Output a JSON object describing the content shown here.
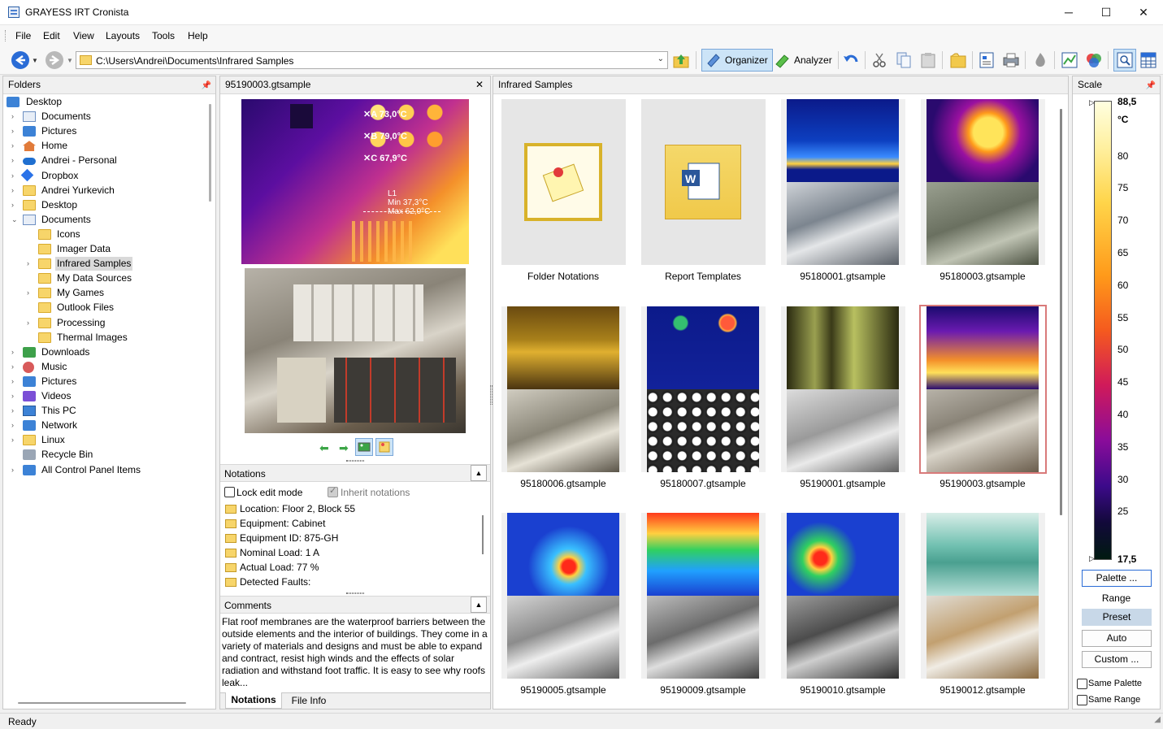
{
  "window": {
    "title": "GRAYESS IRT Cronista",
    "minimize": "─",
    "maximize": "☐",
    "close": "✕"
  },
  "menu": [
    "File",
    "Edit",
    "View",
    "Layouts",
    "Tools",
    "Help"
  ],
  "toolbar": {
    "path": "C:\\Users\\Andrei\\Documents\\Infrared Samples",
    "organizer_label": "Organizer",
    "analyzer_label": "Analyzer"
  },
  "folders": {
    "title": "Folders",
    "items": [
      {
        "label": "Desktop",
        "icon": "desktop-icon",
        "depth": 0,
        "expander": ""
      },
      {
        "label": "Documents",
        "icon": "documents-icon",
        "depth": 1,
        "expander": "›"
      },
      {
        "label": "Pictures",
        "icon": "pictures-icon",
        "depth": 1,
        "expander": "›"
      },
      {
        "label": "Home",
        "icon": "home-icon",
        "depth": 1,
        "expander": "›"
      },
      {
        "label": "Andrei - Personal",
        "icon": "onedrive-icon",
        "depth": 1,
        "expander": "›"
      },
      {
        "label": "Dropbox",
        "icon": "dropbox-icon",
        "depth": 1,
        "expander": "›"
      },
      {
        "label": "Andrei Yurkevich",
        "icon": "folder-icon",
        "depth": 1,
        "expander": "›"
      },
      {
        "label": "Desktop",
        "icon": "folder-icon",
        "depth": 1,
        "expander": "›"
      },
      {
        "label": "Documents",
        "icon": "documents-icon",
        "depth": 1,
        "expander": "⌄"
      },
      {
        "label": "Icons",
        "icon": "folder-icon",
        "depth": 2,
        "expander": ""
      },
      {
        "label": "Imager Data",
        "icon": "folder-icon",
        "depth": 2,
        "expander": ""
      },
      {
        "label": "Infrared Samples",
        "icon": "folder-icon",
        "depth": 2,
        "expander": "›"
      },
      {
        "label": "My Data Sources",
        "icon": "data-sources-icon",
        "depth": 2,
        "expander": ""
      },
      {
        "label": "My Games",
        "icon": "folder-icon",
        "depth": 2,
        "expander": "›"
      },
      {
        "label": "Outlook Files",
        "icon": "folder-icon",
        "depth": 2,
        "expander": ""
      },
      {
        "label": "Processing",
        "icon": "folder-icon",
        "depth": 2,
        "expander": "›"
      },
      {
        "label": "Thermal Images",
        "icon": "folder-icon",
        "depth": 2,
        "expander": ""
      },
      {
        "label": "Downloads",
        "icon": "downloads-icon",
        "depth": 1,
        "expander": "›"
      },
      {
        "label": "Music",
        "icon": "music-icon",
        "depth": 1,
        "expander": "›"
      },
      {
        "label": "Pictures",
        "icon": "pictures-icon",
        "depth": 1,
        "expander": "›"
      },
      {
        "label": "Videos",
        "icon": "videos-icon",
        "depth": 1,
        "expander": "›"
      },
      {
        "label": "This PC",
        "icon": "this-pc-icon",
        "depth": 1,
        "expander": "›"
      },
      {
        "label": "Network",
        "icon": "network-icon",
        "depth": 1,
        "expander": "›"
      },
      {
        "label": "Linux",
        "icon": "linux-icon",
        "depth": 1,
        "expander": "›"
      },
      {
        "label": "Recycle Bin",
        "icon": "recycle-bin-icon",
        "depth": 1,
        "expander": ""
      },
      {
        "label": "All Control Panel Items",
        "icon": "control-panel-icon",
        "depth": 1,
        "expander": "›"
      }
    ],
    "selected": "Infrared Samples"
  },
  "preview": {
    "title": "95190003.gtsample",
    "markers": [
      {
        "label": "A 73,0°C"
      },
      {
        "label": "B 79,0°C"
      },
      {
        "label": "C 67,9°C"
      }
    ],
    "line_label": "L1",
    "line_min": "Min  37,3°C",
    "line_max": "Max  62,0°C"
  },
  "notations": {
    "title": "Notations",
    "lock_edit": "Lock edit mode",
    "inherit": "Inherit notations",
    "items": [
      "Location: Floor 2, Block 55",
      "Equipment: Cabinet",
      "Equipment ID: 875-GH",
      "Nominal Load: 1 A",
      "Actual Load: 77 %",
      "Detected Faults:"
    ]
  },
  "comments": {
    "title": "Comments",
    "text": "Flat roof membranes are the waterproof barriers between the outside elements and the interior of buildings. They come in a variety of materials and designs and must be able to expand and contract, resist high winds and the effects of solar radiation and withstand foot traffic. It is easy to see why roofs leak..."
  },
  "bottom_tabs": [
    "Notations",
    "File Info"
  ],
  "grid": {
    "title": "Infrared Samples",
    "tiles": [
      {
        "label": "Folder Notations",
        "kind": "folder-notations"
      },
      {
        "label": "Report Templates",
        "kind": "report-templates"
      },
      {
        "label": "95180001.gtsample",
        "kind": "sample"
      },
      {
        "label": "95180003.gtsample",
        "kind": "sample"
      },
      {
        "label": "95180006.gtsample",
        "kind": "sample"
      },
      {
        "label": "95180007.gtsample",
        "kind": "sample"
      },
      {
        "label": "95190001.gtsample",
        "kind": "sample"
      },
      {
        "label": "95190003.gtsample",
        "kind": "sample"
      },
      {
        "label": "95190005.gtsample",
        "kind": "sample"
      },
      {
        "label": "95190009.gtsample",
        "kind": "sample"
      },
      {
        "label": "95190010.gtsample",
        "kind": "sample"
      },
      {
        "label": "95190012.gtsample",
        "kind": "sample"
      }
    ],
    "selected": "95190003.gtsample"
  },
  "scale": {
    "title": "Scale",
    "max": "88,5",
    "unit": "°C",
    "min": "17,5",
    "ticks": [
      "80",
      "75",
      "70",
      "65",
      "60",
      "55",
      "50",
      "45",
      "40",
      "35",
      "30",
      "25"
    ],
    "palette_btn": "Palette ...",
    "range_label": "Range",
    "preset_btn": "Preset",
    "auto_btn": "Auto",
    "custom_btn": "Custom ...",
    "same_palette": "Same Palette",
    "same_range": "Same Range"
  },
  "status": "Ready"
}
